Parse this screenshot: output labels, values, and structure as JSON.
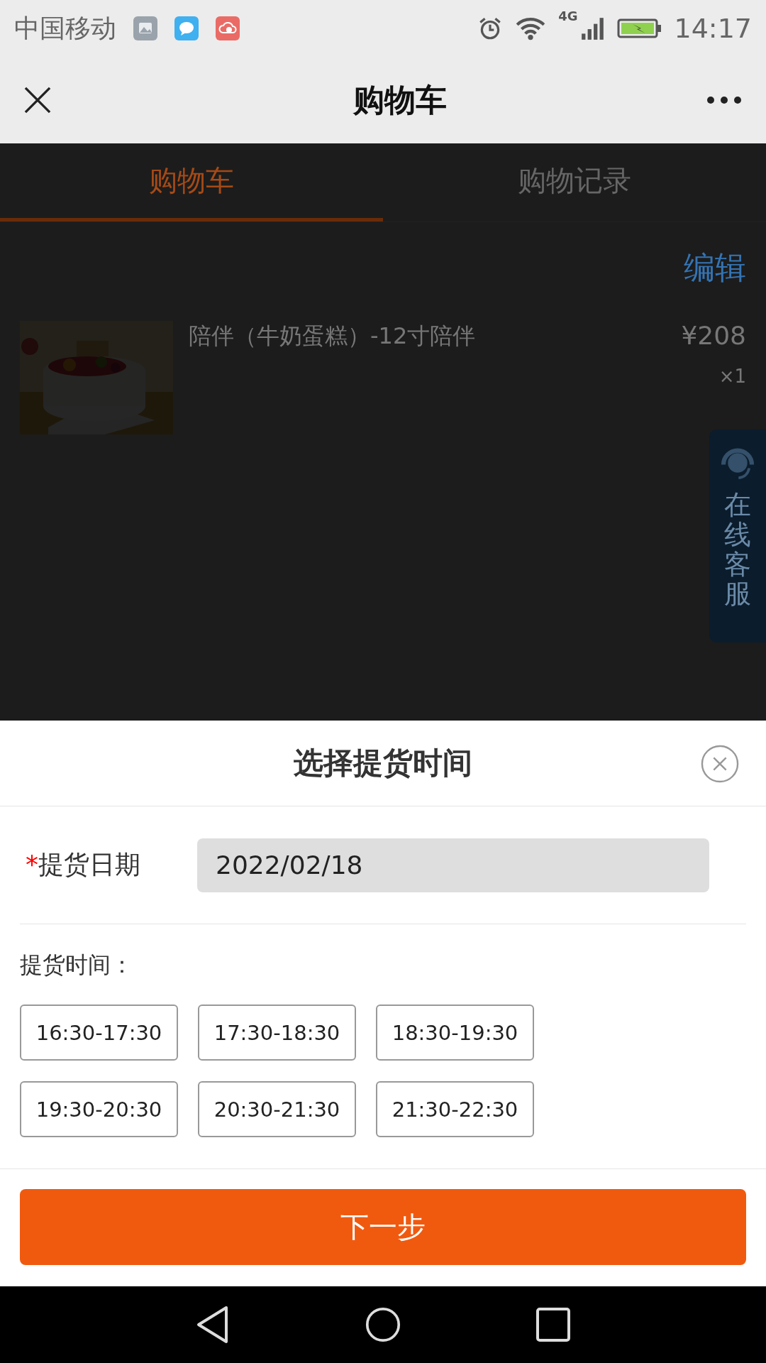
{
  "status_bar": {
    "carrier": "中国移动",
    "network": "4G",
    "time": "14:17"
  },
  "nav_bar": {
    "title": "购物车"
  },
  "tabs": [
    {
      "label": "购物车",
      "selected": true
    },
    {
      "label": "购物记录",
      "selected": false
    }
  ],
  "edit_link": "编辑",
  "cart_items": [
    {
      "kind": "picture",
      "name": "陪伴（牛奶蛋糕）-12寸陪伴",
      "price": "¥208",
      "quantity": "×1"
    }
  ],
  "service_button": "在线客服",
  "sheet": {
    "title": "选择提货时间",
    "date_field": {
      "required_mark": "*",
      "label": "提货日期",
      "value": "2022/02/18"
    },
    "time_label": "提货时间：",
    "time_slots": [
      {
        "label": "16:30-17:30",
        "selected": false
      },
      {
        "label": "17:30-18:30",
        "selected": false
      },
      {
        "label": "18:30-19:30",
        "selected": false
      },
      {
        "label": "19:30-20:30",
        "selected": false
      },
      {
        "label": "20:30-21:30",
        "selected": false
      },
      {
        "label": "21:30-22:30",
        "selected": false
      }
    ],
    "next_button": "下一步"
  }
}
